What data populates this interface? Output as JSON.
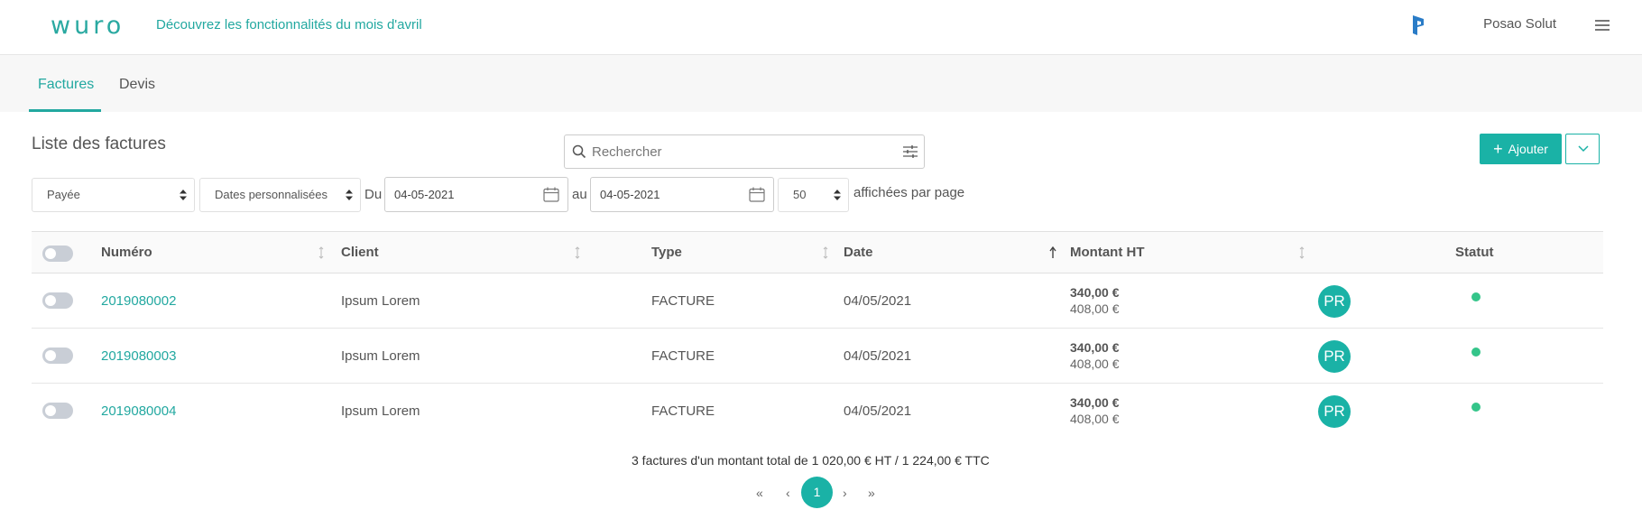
{
  "header": {
    "logo": "wuro",
    "promo_link": "Découvrez les fonctionnalités du mois d'avril",
    "company_name": "Posao Solut"
  },
  "tabs": [
    {
      "label": "Factures",
      "active": true
    },
    {
      "label": "Devis",
      "active": false
    }
  ],
  "list": {
    "title": "Liste des factures",
    "search_placeholder": "Rechercher",
    "add_button": "Ajouter"
  },
  "filters": {
    "status": "Payée",
    "date_range": "Dates personnalisées",
    "from_label": "Du",
    "from_date": "04-05-2021",
    "to_label": "au",
    "to_date": "04-05-2021",
    "per_page": "50",
    "per_page_label": "affichées par page"
  },
  "table": {
    "columns": {
      "numero": "Numéro",
      "client": "Client",
      "type": "Type",
      "date": "Date",
      "montant": "Montant HT",
      "statut": "Statut"
    },
    "rows": [
      {
        "numero": "2019080002",
        "client": "Ipsum Lorem",
        "type": "FACTURE",
        "date": "04/05/2021",
        "ht": "340,00 €",
        "ttc": "408,00 €",
        "avatar": "PR"
      },
      {
        "numero": "2019080003",
        "client": "Ipsum Lorem",
        "type": "FACTURE",
        "date": "04/05/2021",
        "ht": "340,00 €",
        "ttc": "408,00 €",
        "avatar": "PR"
      },
      {
        "numero": "2019080004",
        "client": "Ipsum Lorem",
        "type": "FACTURE",
        "date": "04/05/2021",
        "ht": "340,00 €",
        "ttc": "408,00 €",
        "avatar": "PR"
      }
    ]
  },
  "summary": "3 factures d'un montant total de 1 020,00 € HT / 1 224,00 € TTC",
  "pagination": {
    "first": "«",
    "prev": "‹",
    "current": "1",
    "next": "›",
    "last": "»"
  },
  "colors": {
    "accent": "#1ab2a6",
    "link": "#22a8a0",
    "status_paid": "#34c58a"
  }
}
